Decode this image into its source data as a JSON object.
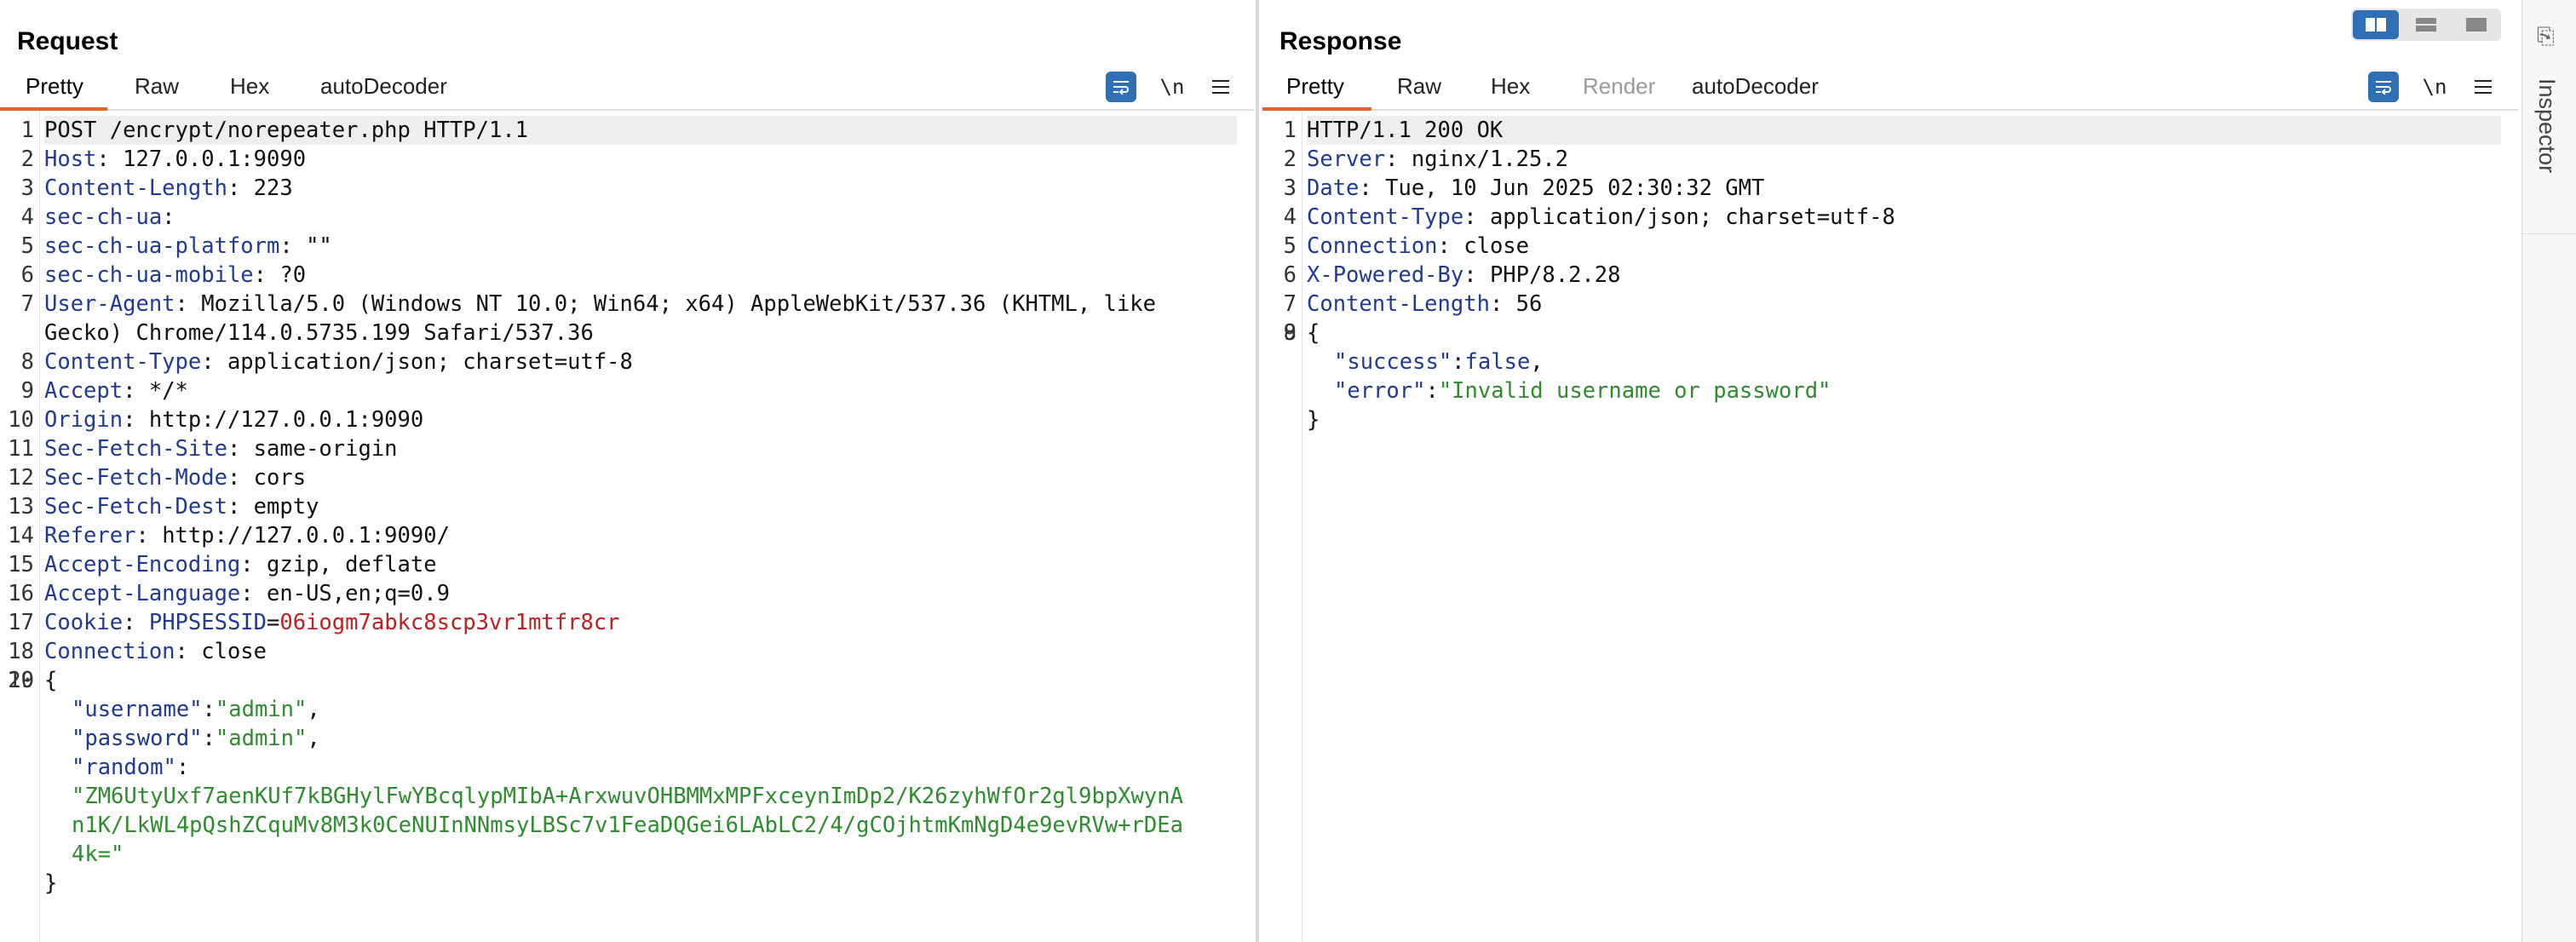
{
  "request": {
    "title": "Request",
    "tabs": [
      "Pretty",
      "Raw",
      "Hex",
      "autoDecoder"
    ],
    "toolbar": {
      "newline_label": "\\n"
    },
    "request_line": "POST /encrypt/norepeater.php HTTP/1.1",
    "headers": [
      {
        "name": "Host",
        "value": "127.0.0.1:9090"
      },
      {
        "name": "Content-Length",
        "value": "223"
      },
      {
        "name": "sec-ch-ua",
        "value": ""
      },
      {
        "name": "sec-ch-ua-platform",
        "value": "\"\""
      },
      {
        "name": "sec-ch-ua-mobile",
        "value": "?0"
      },
      {
        "name": "User-Agent",
        "value": "Mozilla/5.0 (Windows NT 10.0; Win64; x64) AppleWebKit/537.36 (KHTML, like",
        "value_cont": "Gecko) Chrome/114.0.5735.199 Safari/537.36"
      },
      {
        "name": "Content-Type",
        "value": "application/json; charset=utf-8"
      },
      {
        "name": "Accept",
        "value": "*/*"
      },
      {
        "name": "Origin",
        "value": "http://127.0.0.1:9090"
      },
      {
        "name": "Sec-Fetch-Site",
        "value": "same-origin"
      },
      {
        "name": "Sec-Fetch-Mode",
        "value": "cors"
      },
      {
        "name": "Sec-Fetch-Dest",
        "value": "empty"
      },
      {
        "name": "Referer",
        "value": "http://127.0.0.1:9090/"
      },
      {
        "name": "Accept-Encoding",
        "value": "gzip, deflate"
      },
      {
        "name": "Accept-Language",
        "value": "en-US,en;q=0.9"
      }
    ],
    "cookie": {
      "name": "Cookie",
      "cookie_name": "PHPSESSID",
      "cookie_value": "06iogm7abkc8scp3vr1mtfr8cr"
    },
    "connection": {
      "name": "Connection",
      "value": "close"
    },
    "body": {
      "open": "{",
      "username_key": "\"username\"",
      "username_value": "\"admin\"",
      "password_key": "\"password\"",
      "password_value": "\"admin\"",
      "random_key": "\"random\"",
      "random_value_lines": [
        "\"ZM6UtyUxf7aenKUf7kBGHylFwYBcqlypMIbA+ArxwuvOHBMMxMPFxceynImDp2/K26zyhWfOr2gl9bpXwynA",
        "n1K/LkWL4pQshZCquMv8M3k0CeNUInNNmsyLBSc7v1FeaDQGei6LAbLC2/4/gCOjhtmKmNgD4e9evRVw+rDEa",
        "4k=\""
      ],
      "close": "}"
    }
  },
  "response": {
    "title": "Response",
    "tabs": [
      "Pretty",
      "Raw",
      "Hex",
      "Render",
      "autoDecoder"
    ],
    "toolbar": {
      "newline_label": "\\n"
    },
    "status_line": "HTTP/1.1 200 OK",
    "headers": [
      {
        "name": "Server",
        "value": "nginx/1.25.2"
      },
      {
        "name": "Date",
        "value": "Tue, 10 Jun 2025 02:30:32 GMT"
      },
      {
        "name": "Content-Type",
        "value": "application/json; charset=utf-8"
      },
      {
        "name": "Connection",
        "value": "close"
      },
      {
        "name": "X-Powered-By",
        "value": "PHP/8.2.28"
      },
      {
        "name": "Content-Length",
        "value": "56"
      }
    ],
    "body": {
      "open": "{",
      "success_key": "\"success\"",
      "success_value": "false",
      "error_key": "\"error\"",
      "error_value": "\"Invalid username or password\"",
      "close": "}"
    }
  },
  "sidebar": {
    "label": "Inspector"
  },
  "icons": {
    "wrap": "word-wrap-icon",
    "newline": "newline-icon",
    "menu": "hamburger-menu-icon",
    "inspector": "inspector-icon",
    "layout_side": "layout-side-by-side-icon",
    "layout_horizontal": "layout-horizontal-icon",
    "layout_tabs": "layout-tabs-icon"
  },
  "colors": {
    "accent": "#e8642b",
    "button_blue": "#2f6fb5",
    "header_key": "#1f3a93",
    "json_string": "#2e8b2e",
    "cookie_value": "#c02020"
  }
}
